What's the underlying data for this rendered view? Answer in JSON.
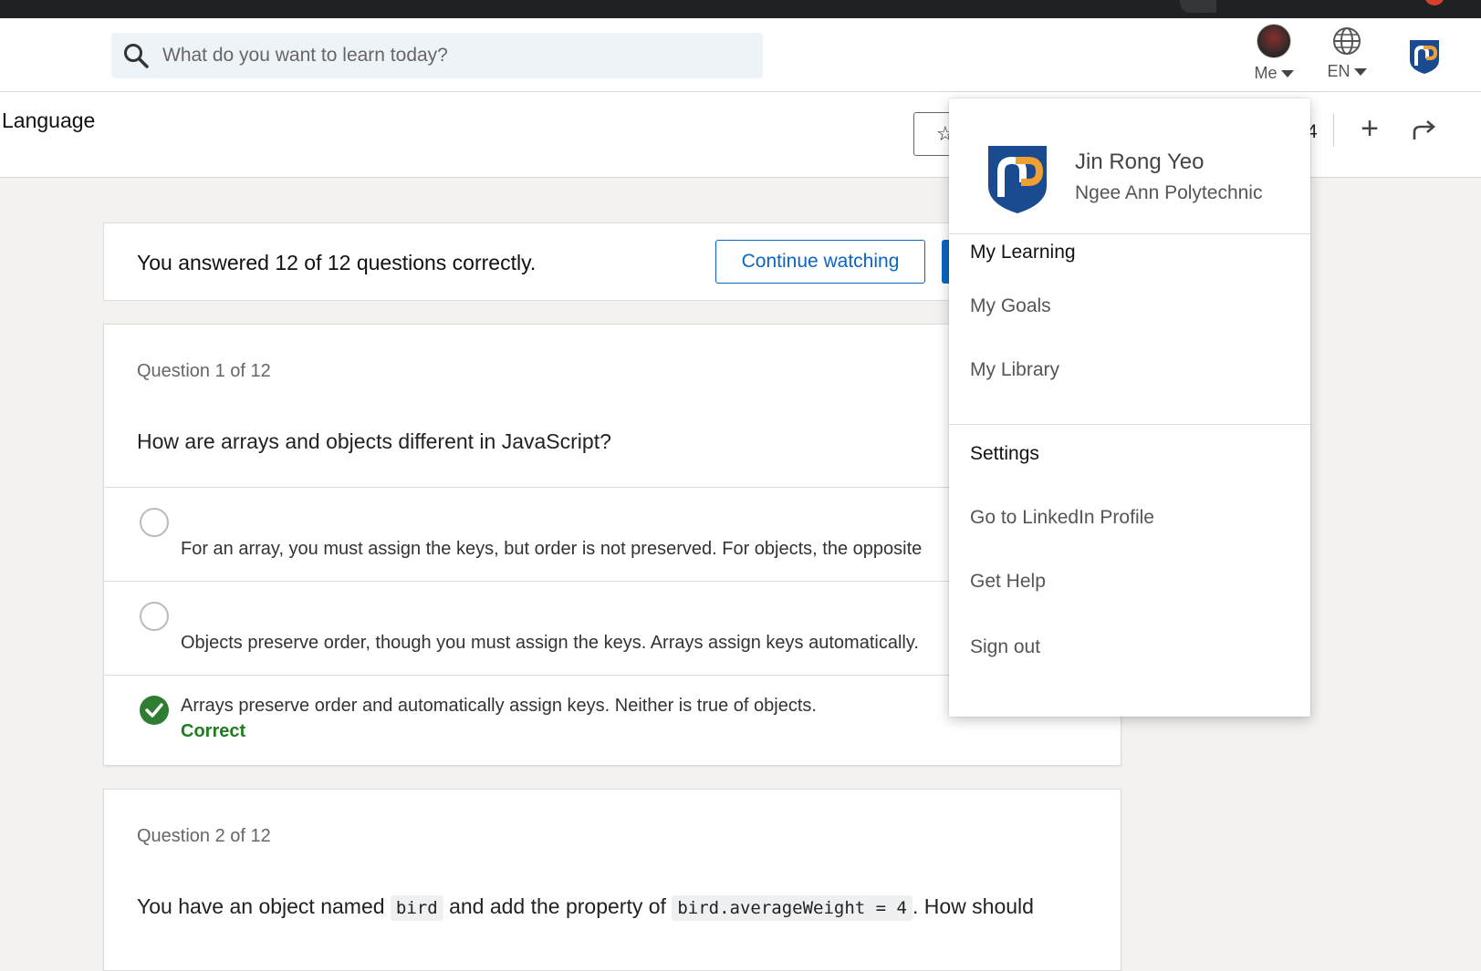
{
  "search": {
    "placeholder": "What do you want to learn today?"
  },
  "nav": {
    "me_label": "Me",
    "lang_label": "EN"
  },
  "subheader": {
    "title": "Language",
    "counter_fragment": "4",
    "add_icon": "+"
  },
  "banner": {
    "message": "You answered 12 of 12 questions correctly.",
    "continue_label": "Continue watching"
  },
  "question1": {
    "number": "Question 1 of 12",
    "text": "How are arrays and objects different in JavaScript?",
    "options": [
      {
        "text": "For an array, you must assign the keys, but order is not preserved. For objects, the opposite"
      },
      {
        "text": "Objects preserve order, though you must assign the keys. Arrays assign keys automatically."
      },
      {
        "text": "Arrays preserve order and automatically assign keys. Neither is true of objects.",
        "status": "Correct"
      }
    ]
  },
  "question2": {
    "number": "Question 2 of 12",
    "text_part1": "You have an object named",
    "code1": "bird",
    "text_part2": "and add the property of",
    "code2": "bird.averageWeight = 4",
    "text_part3": ". How should"
  },
  "dropdown": {
    "name": "Jin Rong Yeo",
    "org": "Ngee Ann Polytechnic",
    "items": [
      "My Learning",
      "My Goals",
      "My Library",
      "Settings",
      "Go to LinkedIn Profile",
      "Get Help",
      "Sign out"
    ]
  },
  "colors": {
    "accent": "#0a66c2",
    "correct": "#1e7d1e",
    "logo_blue": "#1a4a8f",
    "logo_orange": "#f0a030"
  }
}
